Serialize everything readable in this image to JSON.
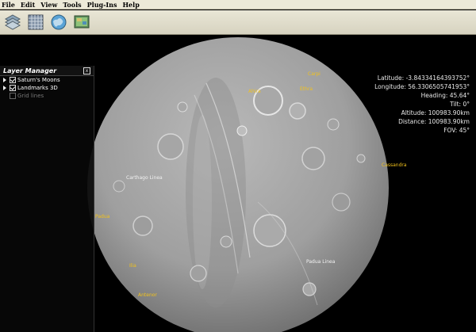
{
  "menu": [
    "File",
    "Edit",
    "View",
    "Tools",
    "Plug-Ins",
    "Help"
  ],
  "toolbar": [
    {
      "name": "layers-icon"
    },
    {
      "name": "grid-icon"
    },
    {
      "name": "globe-icon"
    },
    {
      "name": "map-icon"
    }
  ],
  "readout": {
    "latitude": "Latitude: -3.84334164393752°",
    "longitude": "Longitude: 56.3306505741953°",
    "heading": "Heading: 45.64°",
    "tilt": "Tilt: 0°",
    "altitude": "Altitude: 100983.90km",
    "distance": "Distance: 100983.90km",
    "fov": "FOV: 45°"
  },
  "layer_manager": {
    "title": "Layer Manager",
    "close": "x",
    "items": [
      {
        "label": "Saturn's Moons",
        "checked": true,
        "enabled": true
      },
      {
        "label": "Landmarks 3D",
        "checked": true,
        "enabled": true
      },
      {
        "label": "Grid lines",
        "checked": false,
        "enabled": false
      }
    ]
  },
  "landmarks": [
    {
      "label": "Carpi",
      "color": "#f2c21b"
    },
    {
      "label": "Ahira",
      "color": "#f2c21b"
    },
    {
      "label": "Ethra",
      "color": "#f2c21b"
    },
    {
      "label": "Cassandra",
      "color": "#f2c21b"
    },
    {
      "label": "Carthago Linea",
      "color": "#f2f2f2"
    },
    {
      "label": "Padua",
      "color": "#f2c21b"
    },
    {
      "label": "Ilia",
      "color": "#f2c21b"
    },
    {
      "label": "Antenor",
      "color": "#f2c21b"
    },
    {
      "label": "Padua Linea",
      "color": "#f2f2f2"
    }
  ]
}
